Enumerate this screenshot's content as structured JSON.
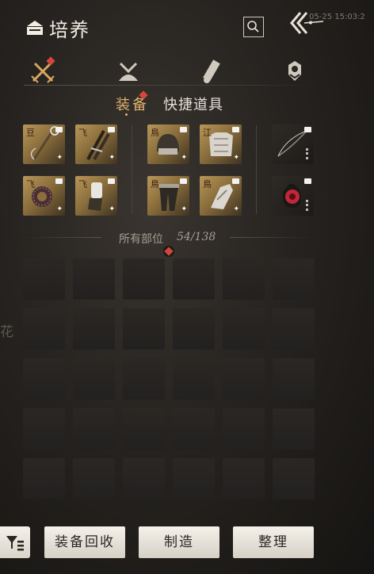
{
  "header": {
    "title": "培养",
    "timestamp": "05-25 15:03:2",
    "title_icon": "basket-icon",
    "search_icon": "search-icon",
    "back_icon": "double-chevron-left-icon"
  },
  "category_tabs": [
    {
      "id": "equipment",
      "icon": "crossed-swords-icon",
      "active": true,
      "has_alert": true
    },
    {
      "id": "bag",
      "icon": "bundle-icon",
      "active": false
    },
    {
      "id": "scroll",
      "icon": "scroll-icon",
      "active": false
    },
    {
      "id": "token",
      "icon": "medallion-icon",
      "active": false
    }
  ],
  "sub_tabs": [
    {
      "label": "装备",
      "active": true,
      "has_alert": true
    },
    {
      "label": "快捷道具",
      "active": false
    }
  ],
  "equipped": {
    "group1": [
      {
        "grade": "豆",
        "item": "flail-icon",
        "star": "✦"
      },
      {
        "grade": "飞",
        "item": "twin-swords-icon",
        "star": "✦"
      },
      {
        "grade": "飞",
        "item": "bracelet-icon",
        "star": "✦"
      },
      {
        "grade": "飞",
        "item": "gauntlet-icon",
        "star": "✦"
      }
    ],
    "group2": [
      {
        "grade": "鳥",
        "item": "helmet-icon",
        "star": "✦"
      },
      {
        "grade": "江",
        "item": "chest-armor-icon",
        "star": "✦"
      },
      {
        "grade": "鳥",
        "item": "leg-armor-icon",
        "star": "✦"
      },
      {
        "grade": "鳥",
        "item": "boots-icon",
        "star": "✦"
      }
    ],
    "group3": [
      {
        "grade": "",
        "item": "bow-icon",
        "star": "",
        "dark": true
      },
      {
        "grade": "",
        "item": "red-pouch-icon",
        "star": "",
        "dark": true
      }
    ]
  },
  "section": {
    "label": "所有部位",
    "count": "54/138"
  },
  "side_text": "花",
  "inventory": {
    "rows": 5,
    "cols": 6
  },
  "bottom": {
    "filter_icon": "filter-list-icon",
    "buttons": [
      {
        "label": "装备回收"
      },
      {
        "label": "制造"
      },
      {
        "label": "整理"
      }
    ]
  },
  "colors": {
    "accent": "#e0b26e",
    "alert": "#d3473b",
    "slot_gold": "#b89658"
  }
}
